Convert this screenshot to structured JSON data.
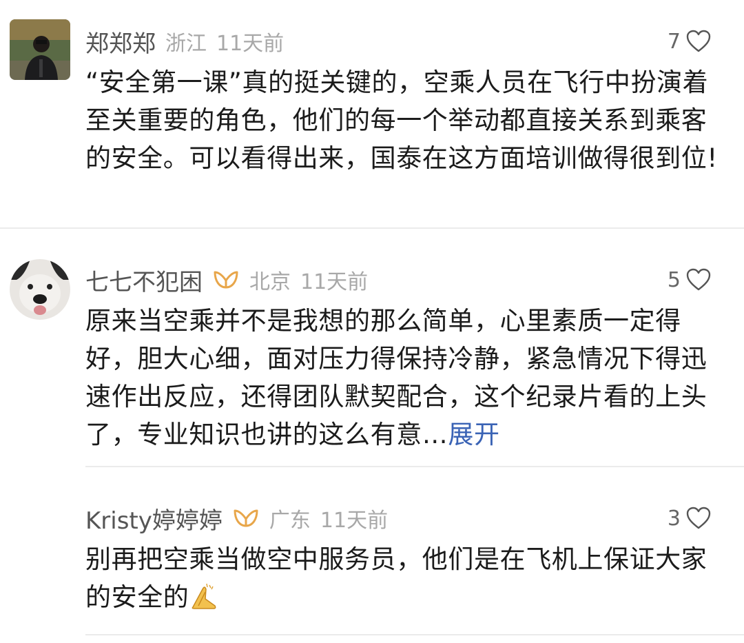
{
  "comments": [
    {
      "username": "郑郑郑",
      "location": "浙江",
      "time": "11天前",
      "likes": "7",
      "text": "“安全第一课”真的挺关键的，空乘人员在飞行中扮演着至关重要的角色，他们的每一个举动都直接关系到乘客的安全。可以看得出来，国泰在这方面培训做得很到位!",
      "avatar": "person-avatar"
    },
    {
      "username": "七七不犯困",
      "location": "北京",
      "time": "11天前",
      "likes": "5",
      "text": "原来当空乘并不是我想的那么简单，心里素质一定得好，胆大心细，面对压力得保持冷静，紧急情况下得迅速作出反应，还得团队默契配合，这个纪录片看的上头了，专业知识也讲的这么有意…",
      "expand": "展开",
      "avatar": "dog-avatar"
    },
    {
      "username": "Kristy婷婷婷",
      "location": "广东",
      "time": "11天前",
      "likes": "3",
      "text": "别再把空乘当做空中服务员，他们是在飞机上保证大家的安全的",
      "emoji": "praying-hands-icon",
      "avatar": "none"
    }
  ],
  "colors": {
    "vip_badge": "#e8a64a",
    "expand_link": "#3a63b5",
    "meta_gray": "#a8a8a8"
  }
}
